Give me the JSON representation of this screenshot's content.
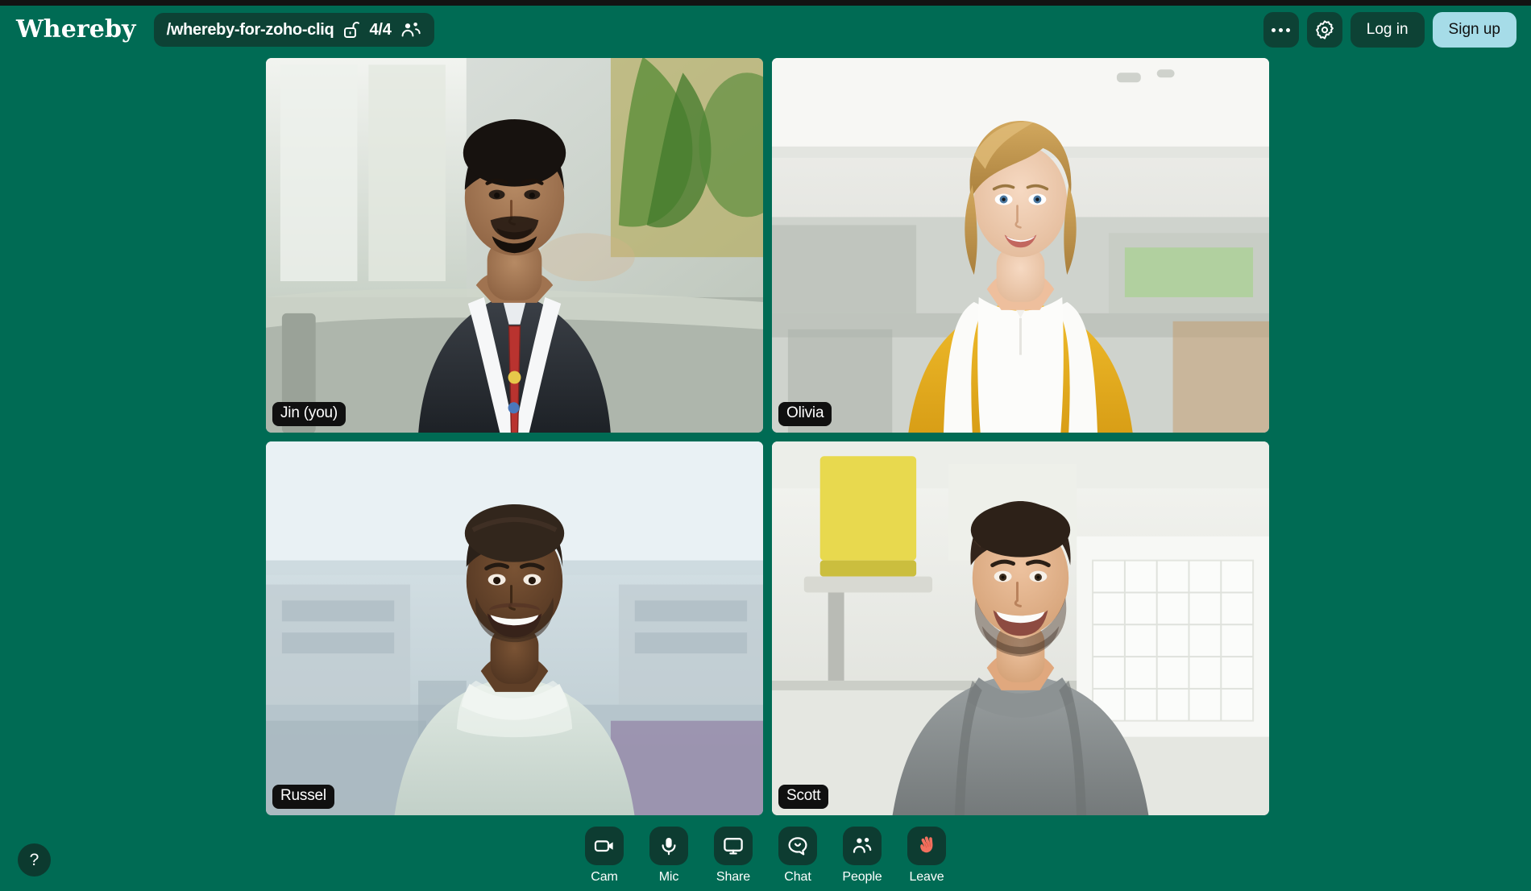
{
  "app": {
    "brand": "Whereby",
    "background_color": "#006b54",
    "panel_color": "#0d4235",
    "accent_color": "#a6dce8",
    "leave_color": "#f2705e"
  },
  "topbar": {
    "logo_text": "Whereby",
    "room": {
      "name": "/whereby-for-zoho-cliq",
      "lock_icon": "unlocked-padlock-icon",
      "participant_count": "4/4",
      "people_icon": "people-icon"
    },
    "more_menu": {
      "icon": "more-horizontal-icon",
      "label": "More options"
    },
    "settings": {
      "icon": "gear-icon",
      "label": "Settings"
    },
    "login_label": "Log in",
    "signup_label": "Sign up"
  },
  "grid": {
    "tiles": [
      {
        "name": "Jin (you)",
        "is_self": true,
        "position": "top-left"
      },
      {
        "name": "Olivia",
        "is_self": false,
        "position": "top-right"
      },
      {
        "name": "Russel",
        "is_self": false,
        "position": "bottom-left"
      },
      {
        "name": "Scott",
        "is_self": false,
        "position": "bottom-right"
      }
    ]
  },
  "toolbar": {
    "items": [
      {
        "label": "Cam",
        "icon": "video-camera-icon"
      },
      {
        "label": "Mic",
        "icon": "microphone-icon"
      },
      {
        "label": "Share",
        "icon": "screen-share-icon"
      },
      {
        "label": "Chat",
        "icon": "chat-bubble-icon"
      },
      {
        "label": "People",
        "icon": "people-icon"
      },
      {
        "label": "Leave",
        "icon": "waving-hand-icon"
      }
    ]
  },
  "help": {
    "label": "?",
    "icon": "question-mark-icon"
  }
}
